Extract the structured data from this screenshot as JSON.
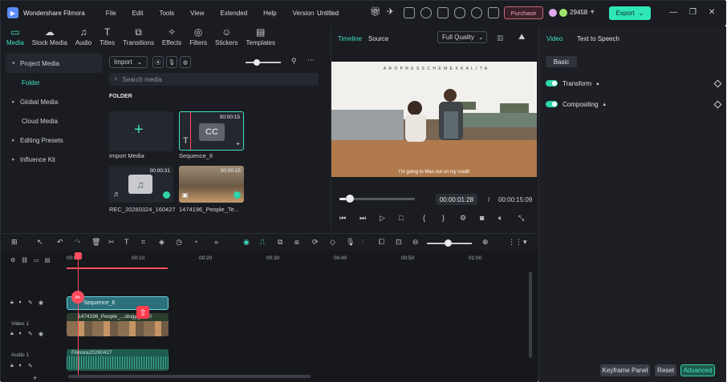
{
  "titlebar": {
    "app_name": "Wondershare Filmora",
    "menus": [
      "File",
      "Edit",
      "Tools",
      "View",
      "Extended",
      "Help",
      "Version"
    ],
    "document_title": "Untitled",
    "purchase_label": "Purchase",
    "credits": "29458",
    "export_label": "Export"
  },
  "media_tabs": [
    {
      "label": "Media",
      "icon": "▭",
      "active": true
    },
    {
      "label": "Stock Media",
      "icon": "☁"
    },
    {
      "label": "Audio",
      "icon": "♫"
    },
    {
      "label": "Titles",
      "icon": "T"
    },
    {
      "label": "Transitions",
      "icon": "⧉"
    },
    {
      "label": "Effects",
      "icon": "✧"
    },
    {
      "label": "Filters",
      "icon": "◎"
    },
    {
      "label": "Stickers",
      "icon": "☺"
    },
    {
      "label": "Templates",
      "icon": "▤"
    }
  ],
  "sidebar": {
    "items": [
      "Project Media",
      "Folder",
      "Global Media",
      "Cloud Media",
      "Editing Presets",
      "Influence Kit"
    ]
  },
  "media": {
    "import_label": "Import",
    "search_placeholder": "Search media",
    "folder_label": "FOLDER",
    "items": [
      {
        "label": "Import Media"
      },
      {
        "label": "Sequence_6",
        "duration": "00:00:15",
        "thumb_text": "CC"
      },
      {
        "label": "REC_20260324_160427",
        "duration": "00:00:31"
      },
      {
        "label": "1474196_People_Te...",
        "duration": "00:00:15"
      }
    ]
  },
  "preview": {
    "tab_timeline": "Timeline",
    "tab_source": "Source",
    "quality": "Full Quality",
    "subtitle": "I'm going to Max out on my credit",
    "sign_text": "A R O P R E S S   C H E M E X   K A L I T A",
    "current_time": "00:00:01:28",
    "separator": "/",
    "total_time": "00:00:15:09",
    "progress": 0.09
  },
  "right_panel": {
    "tab_video": "Video",
    "tab_tts": "Text to Speech",
    "basic_label": "Basic",
    "transform_label": "Transform",
    "compositing_label": "Compositing",
    "keyframe_label": "Keyframe Panel",
    "reset_label": "Reset",
    "advanced_label": "Advanced"
  },
  "timeline": {
    "ruler": [
      "00:00",
      "00:10",
      "00:20",
      "00:30",
      "00:40",
      "00:50",
      "01:00"
    ],
    "video_track_label": "Video 1",
    "audio_track_label": "Audio 1",
    "seq_clip_label": "Sequence_6",
    "video_clip_label": "1474196_People_...ology_1080",
    "audio_clip_label": "Filmora20260427"
  },
  "colors": {
    "accent": "#2ee6b6",
    "playhead": "#ff4d5e"
  }
}
